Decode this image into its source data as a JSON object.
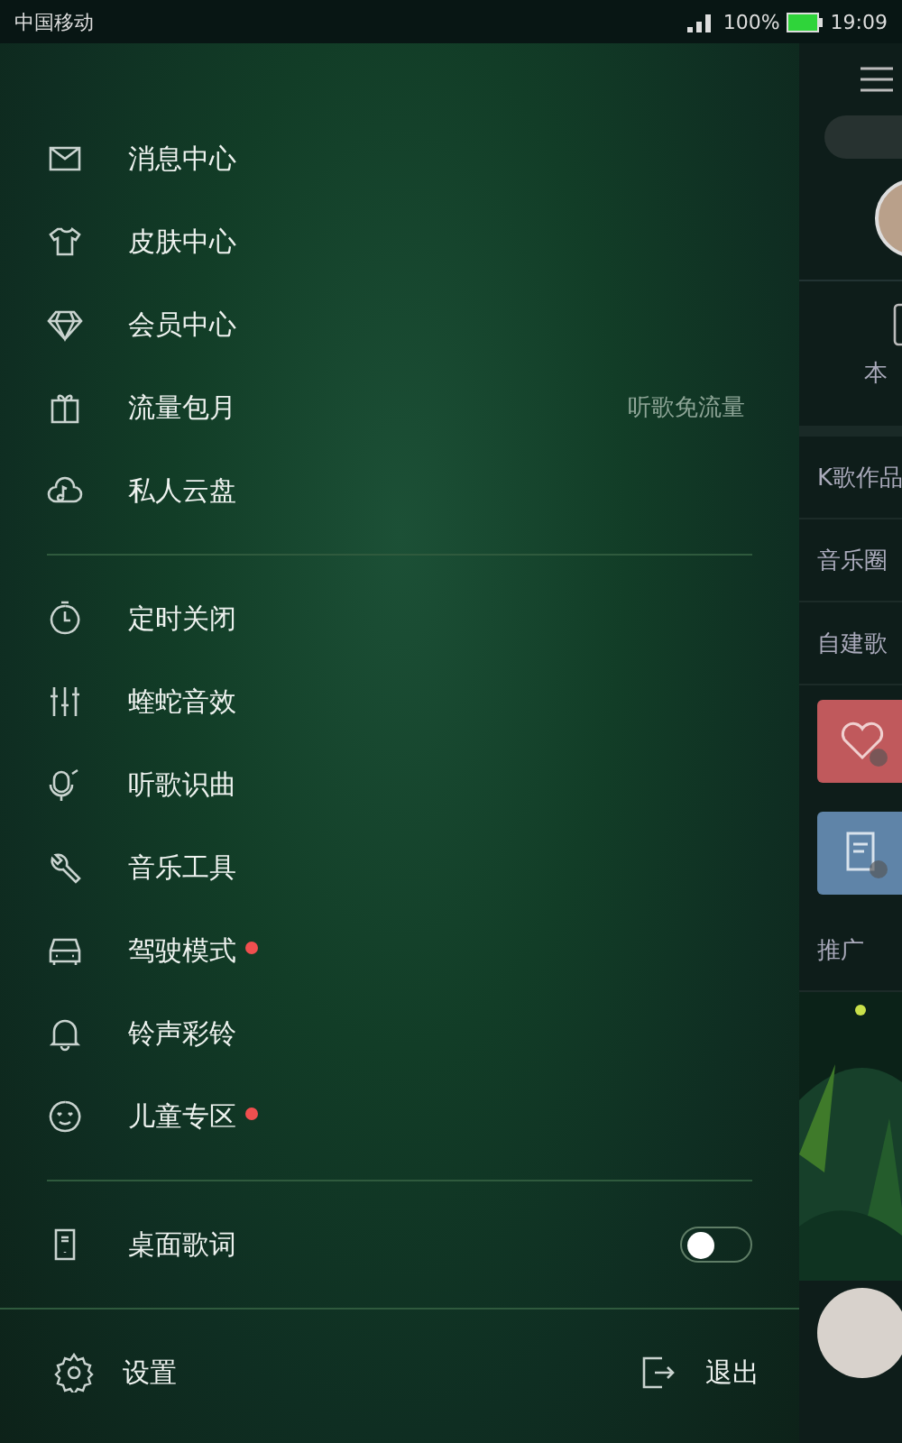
{
  "status_bar": {
    "carrier": "中国移动",
    "battery": "100%",
    "time": "19:09"
  },
  "menu": {
    "sections": [
      {
        "items": [
          {
            "label": "消息中心",
            "kind": "link",
            "dot": false
          },
          {
            "label": "皮肤中心",
            "kind": "link",
            "dot": false
          },
          {
            "label": "会员中心",
            "kind": "link",
            "dot": false
          },
          {
            "label": "流量包月",
            "kind": "link",
            "dot": false,
            "note": "听歌免流量"
          },
          {
            "label": "私人云盘",
            "kind": "link",
            "dot": false
          }
        ]
      },
      {
        "items": [
          {
            "label": "定时关闭",
            "kind": "link",
            "dot": false
          },
          {
            "label": "蝰蛇音效",
            "kind": "link",
            "dot": false
          },
          {
            "label": "听歌识曲",
            "kind": "link",
            "dot": false
          },
          {
            "label": "音乐工具",
            "kind": "link",
            "dot": false
          },
          {
            "label": "驾驶模式",
            "kind": "link",
            "dot": true
          },
          {
            "label": "铃声彩铃",
            "kind": "link",
            "dot": false
          },
          {
            "label": "儿童专区",
            "kind": "link",
            "dot": true
          }
        ]
      },
      {
        "items": [
          {
            "label": "桌面歌词",
            "kind": "toggle",
            "on": false,
            "dot": false
          }
        ]
      }
    ]
  },
  "footer": {
    "settings": "设置",
    "exit": "退出"
  },
  "behind": {
    "local": "本",
    "rows": [
      "K歌作品",
      "音乐圈",
      "自建歌"
    ],
    "tiles": [
      {
        "color": "#c0595c"
      },
      {
        "color": "#5f84a8"
      }
    ],
    "promo": "推广"
  }
}
